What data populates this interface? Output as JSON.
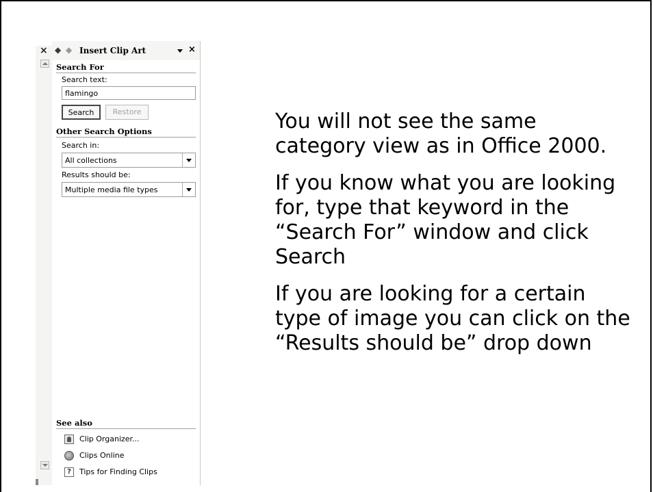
{
  "left_pane": {
    "close_glyph": "×"
  },
  "task_pane": {
    "nav_back_glyph": "◆",
    "nav_forward_glyph": "◆",
    "title": "Insert Clip Art",
    "close_glyph": "×",
    "search_for": {
      "heading": "Search For",
      "search_text_label": "Search text:",
      "search_text_value": "flamingo",
      "search_button": "Search",
      "restore_button": "Restore"
    },
    "other_options": {
      "heading": "Other Search Options",
      "search_in_label": "Search in:",
      "search_in_value": "All collections",
      "results_label": "Results should be:",
      "results_value": "Multiple media file types"
    },
    "see_also": {
      "heading": "See also",
      "links": [
        {
          "label": "Clip Organizer...",
          "icon": "clip-organizer-icon"
        },
        {
          "label": "Clips Online",
          "icon": "clips-online-globe-icon"
        },
        {
          "label": "Tips for Finding Clips",
          "icon": "help-question-icon",
          "glyph": "?"
        }
      ]
    }
  },
  "slide_text": {
    "paragraphs": [
      "You will not see the same category view as in Office 2000.",
      "If you know what you are looking for, type that keyword in the “Search For” window and click Search",
      "If you are looking for a certain type of image you can click on the “Results should be” drop down"
    ]
  }
}
